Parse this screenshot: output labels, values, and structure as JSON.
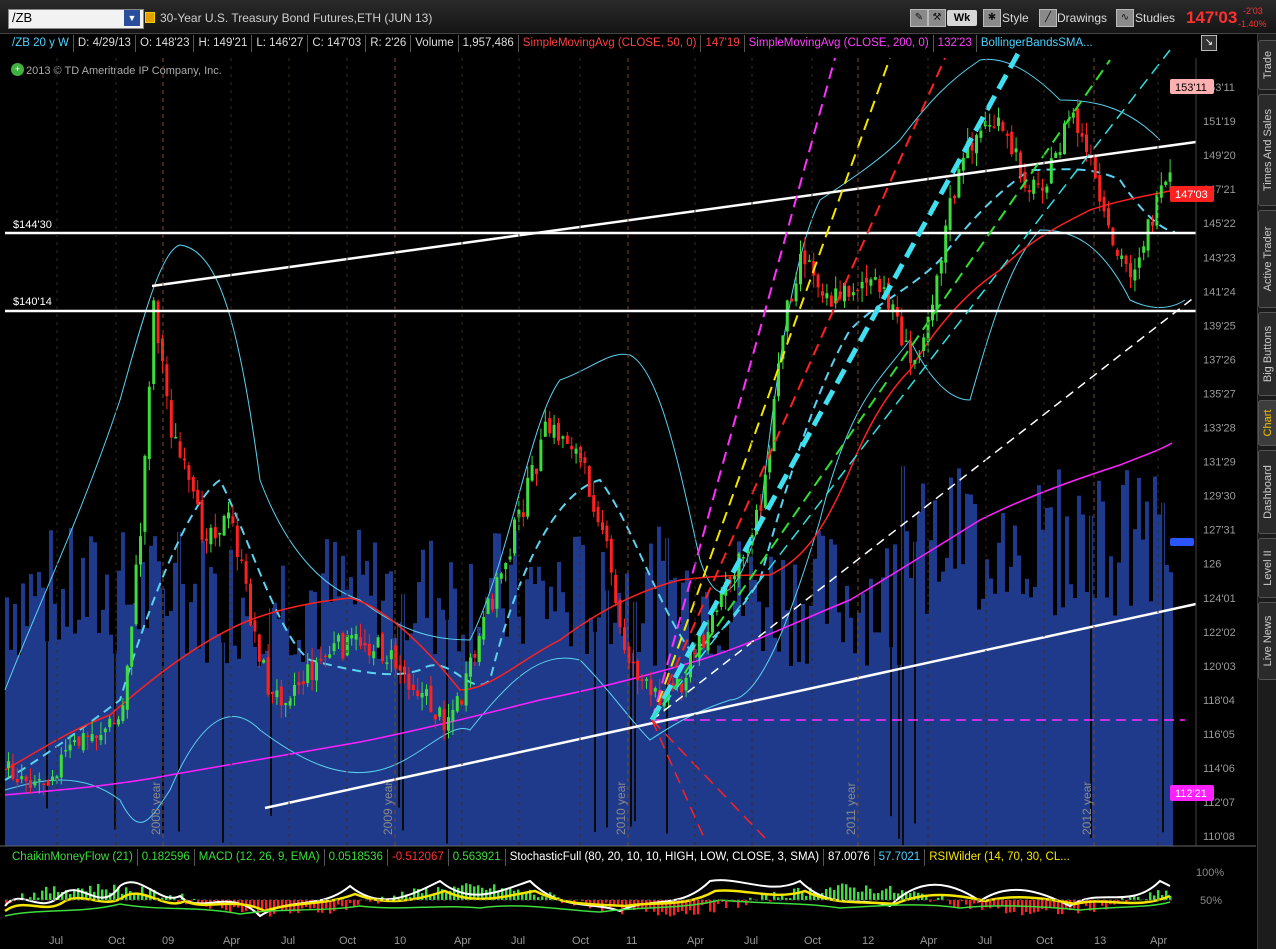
{
  "toolbar": {
    "symbol": "/ZB",
    "instrument_title": "30-Year U.S. Treasury Bond Futures,ETH (JUN 13)",
    "period_button": "Wk",
    "style_label": "Style",
    "drawings_label": "Drawings",
    "studies_label": "Studies",
    "last_price": "147'03",
    "change": "-2'03",
    "change_pct": "-1.40%"
  },
  "right_tabs": [
    "Trade",
    "Times And Sales",
    "Active Trader",
    "Big Buttons",
    "Chart",
    "Dashboard",
    "Level II",
    "Live News"
  ],
  "active_tab": "Chart",
  "header": {
    "symbol_period": "/ZB 20 y W",
    "date": "D: 4/29/13",
    "open": "O: 148'23",
    "high": "H: 149'21",
    "low": "L: 146'27",
    "close": "C: 147'03",
    "range": "R: 2'26",
    "volume_label": "Volume",
    "volume_value": "1,957,486",
    "sma50_label": "SimpleMovingAvg (CLOSE, 50, 0)",
    "sma50_value": "147'19",
    "sma200_label": "SimpleMovingAvg (CLOSE, 200, 0)",
    "sma200_value": "132'23",
    "bb_label": "BollingerBandsSMA..."
  },
  "copyright": "2013 © TD Ameritrade IP Company, Inc.",
  "price_axis": [
    "153'11",
    "151'19",
    "149'20",
    "147'21",
    "145'22",
    "143'23",
    "141'24",
    "139'25",
    "137'26",
    "135'27",
    "133'28",
    "131'29",
    "129'30",
    "127'31",
    "126",
    "124'01",
    "122'02",
    "120'03",
    "118'04",
    "116'05",
    "114'06",
    "112'07",
    "110'08"
  ],
  "price_badges": {
    "high_badge": "153'11",
    "last_badge": "147'03",
    "sma200_badge": "112'21"
  },
  "level_labels": [
    "$144'30",
    "$140'14"
  ],
  "year_labels": [
    "2008 year",
    "2009 year",
    "2010 year",
    "2011 year",
    "2012 year"
  ],
  "time_axis": [
    "Jul",
    "Oct",
    "09",
    "Apr",
    "Jul",
    "Oct",
    "10",
    "Apr",
    "Jul",
    "Oct",
    "11",
    "Apr",
    "Jul",
    "Oct",
    "12",
    "Apr",
    "Jul",
    "Oct",
    "13",
    "Apr"
  ],
  "lower": {
    "cmf_label": "ChaikinMoneyFlow (21)",
    "cmf_value": "0.182596",
    "macd_label": "MACD (12, 26, 9, EMA)",
    "macd_v1": "0.0518536",
    "macd_v2": "-0.512067",
    "macd_v3": "0.563921",
    "stoch_label": "StochasticFull (80, 20, 10, 10, HIGH, LOW, CLOSE, 3, SMA)",
    "stoch_v1": "87.0076",
    "stoch_v2": "57.7021",
    "rsi_label": "RSIWilder (14, 70, 30, CL...",
    "axis_100": "100%",
    "axis_50": "50%"
  },
  "colors": {
    "up": "#3cdd3c",
    "down": "#ff2020",
    "volume": "#1f3a8a",
    "sma50": "#ff2020",
    "sma200": "#ff20ff",
    "bollinger": "#5ad2f0",
    "trendline": "#ffffff"
  }
}
